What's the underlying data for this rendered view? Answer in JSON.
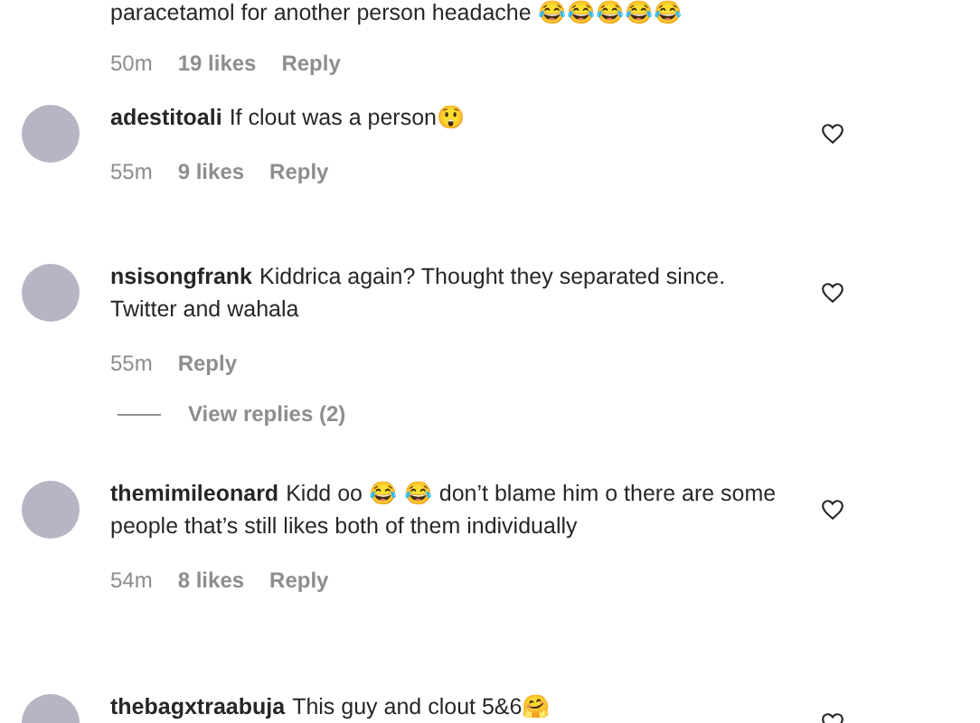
{
  "comments": [
    {
      "kind": "partial",
      "text": "paracetamol for another person headache 😂😂😂😂😂",
      "time": "50m",
      "likes": "19 likes",
      "reply": "Reply"
    },
    {
      "kind": "full",
      "username": "adestitoali",
      "text": "If clout was a person😲",
      "time": "55m",
      "likes": "9 likes",
      "reply": "Reply"
    },
    {
      "kind": "full",
      "username": "nsisongfrank",
      "text": "Kiddrica again? Thought they separated since. Twitter and wahala",
      "time": "55m",
      "reply": "Reply",
      "view_replies": "View replies (2)"
    },
    {
      "kind": "full",
      "username": "themimileonard",
      "text": "Kidd oo 😂 😂 don’t blame him o there are some people that’s still likes both of them individually",
      "time": "54m",
      "likes": "8 likes",
      "reply": "Reply"
    },
    {
      "kind": "cut",
      "username": "thebagxtraabuja",
      "text": "This guy and clout 5&6🤗"
    }
  ]
}
